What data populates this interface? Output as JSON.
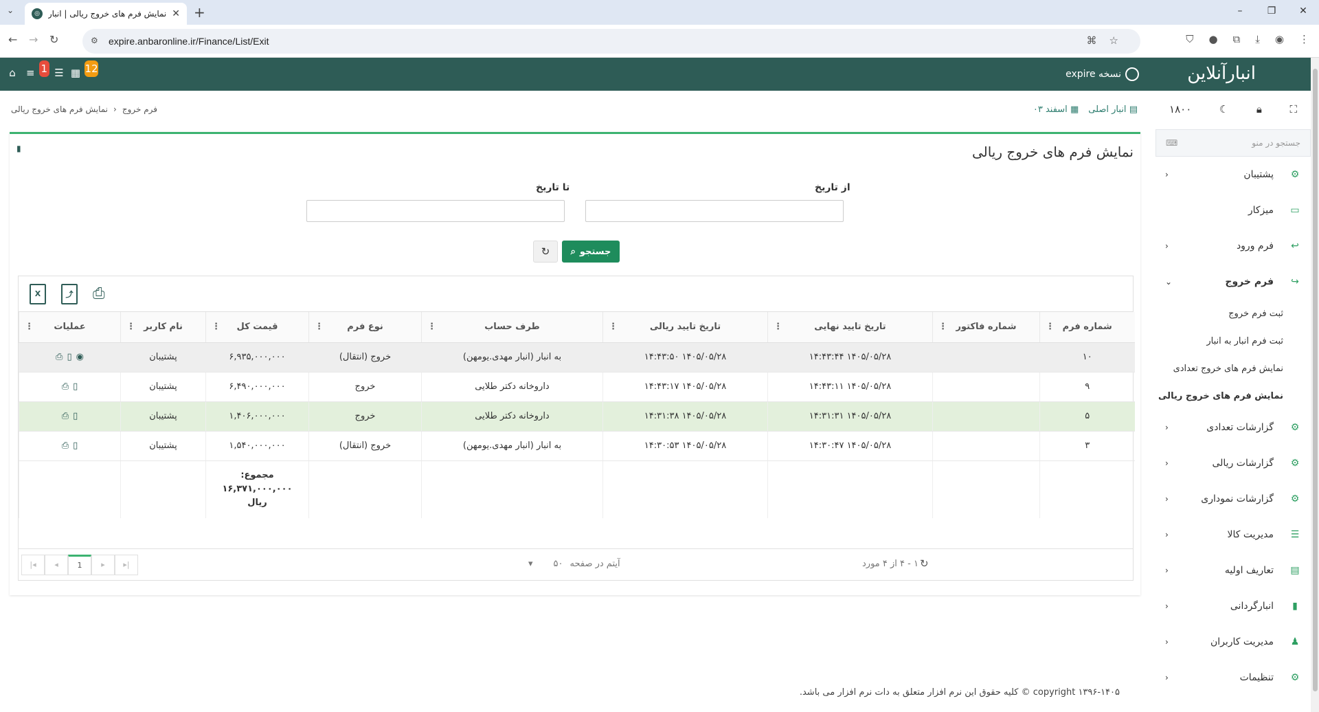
{
  "browser": {
    "tab_title": "نمایش فرم های خروج ریالی | انبار",
    "url": "expire.anbaronline.ir/Finance/List/Exit"
  },
  "header": {
    "logo_text": "انبارآنلاین",
    "user_label": "نسخه expire",
    "badge_notifications": "1",
    "badge_calendar": "12"
  },
  "toolbar": {
    "warehouse": "انبار اصلی",
    "period": "اسفند ۰۳",
    "year": "۱۸۰۰"
  },
  "breadcrumb": {
    "parent": "فرم خروج",
    "current": "نمایش فرم های خروج ریالی"
  },
  "sidebar": {
    "search_placeholder": "جستجو در منو",
    "items": [
      {
        "label": "پشتیبان",
        "icon": "gears-icon",
        "chevron": "‹"
      },
      {
        "label": "میزکار",
        "icon": "desktop-icon",
        "chevron": ""
      },
      {
        "label": "فرم ورود",
        "icon": "reply-icon",
        "chevron": "‹"
      },
      {
        "label": "فرم خروج",
        "icon": "share-icon",
        "chevron": "⌄"
      },
      {
        "label": "گزارشات تعدادی",
        "icon": "gears-icon",
        "chevron": "‹"
      },
      {
        "label": "گزارشات ریالی",
        "icon": "gears-icon",
        "chevron": "‹"
      },
      {
        "label": "گزارشات نموداری",
        "icon": "gears-icon",
        "chevron": "‹"
      },
      {
        "label": "مدیریت کالا",
        "icon": "list-icon",
        "chevron": "‹"
      },
      {
        "label": "تعاریف اولیه",
        "icon": "archive-icon",
        "chevron": "‹"
      },
      {
        "label": "انبارگردانی",
        "icon": "file-icon",
        "chevron": "‹"
      },
      {
        "label": "مدیریت کاربران",
        "icon": "user-icon",
        "chevron": "‹"
      },
      {
        "label": "تنظیمات",
        "icon": "gears-icon",
        "chevron": "‹"
      }
    ],
    "subitems": [
      {
        "label": "ثبت فرم خروج"
      },
      {
        "label": "ثبت فرم انبار به انبار"
      },
      {
        "label": "نمایش فرم های خروج تعدادی"
      },
      {
        "label": "نمایش فرم های خروج ریالی"
      }
    ]
  },
  "main": {
    "title": "نمایش فرم های خروج ریالی",
    "from_date_label": "از تاریخ",
    "to_date_label": "تا تاریخ",
    "search_label": "جستجو",
    "columns": [
      "شماره فرم",
      "شماره فاکتور",
      "تاریخ تایید نهایی",
      "تاریخ تایید ریالی",
      "طرف حساب",
      "نوع فرم",
      "قیمت کل",
      "نام کاربر",
      "عملیات"
    ],
    "rows": [
      [
        "۱۰",
        "",
        "۱۴۰۵/۰۵/۲۸ ۱۴:۴۳:۴۴",
        "۱۴۰۵/۰۵/۲۸ ۱۴:۴۳:۵۰",
        "به انبار (انبار مهدی.یومهن)",
        "خروج (انتقال)",
        "۶,۹۳۵,۰۰۰,۰۰۰",
        "پشتیبان"
      ],
      [
        "۹",
        "",
        "۱۴۰۵/۰۵/۲۸ ۱۴:۴۳:۱۱",
        "۱۴۰۵/۰۵/۲۸ ۱۴:۴۳:۱۷",
        "داروخانه دکتر طلایی",
        "خروج",
        "۶,۴۹۰,۰۰۰,۰۰۰",
        "پشتیبان"
      ],
      [
        "۵",
        "",
        "۱۴۰۵/۰۵/۲۸ ۱۴:۳۱:۳۱",
        "۱۴۰۵/۰۵/۲۸ ۱۴:۳۱:۳۸",
        "داروخانه دکتر طلایی",
        "خروج",
        "۱,۴۰۶,۰۰۰,۰۰۰",
        "پشتیبان"
      ],
      [
        "۳",
        "",
        "۱۴۰۵/۰۵/۲۸ ۱۴:۳۰:۴۷",
        "۱۴۰۵/۰۵/۲۸ ۱۴:۳۰:۵۳",
        "به انبار (انبار مهدی.یومهن)",
        "خروج (انتقال)",
        "۱,۵۴۰,۰۰۰,۰۰۰",
        "پشتیبان"
      ]
    ],
    "total_label": "مجموع:",
    "total_value": "۱۶,۳۷۱,۰۰۰,۰۰۰",
    "total_unit": "ریال",
    "pager": {
      "page": "1",
      "page_size": "۵۰",
      "page_size_label": "آیتم در صفحه",
      "range": "۱ - ۴ از ۴ مورد"
    }
  },
  "footer": {
    "copyright": "copyright ۱۳۹۶-۱۴۰۵ © کلیه حقوق این نرم افزار متعلق به دات نرم افزار می باشد."
  },
  "colors": {
    "header_bg": "#2e5c56",
    "accent_green": "#1e8c5c",
    "selected_row": "#e3f0dc"
  }
}
